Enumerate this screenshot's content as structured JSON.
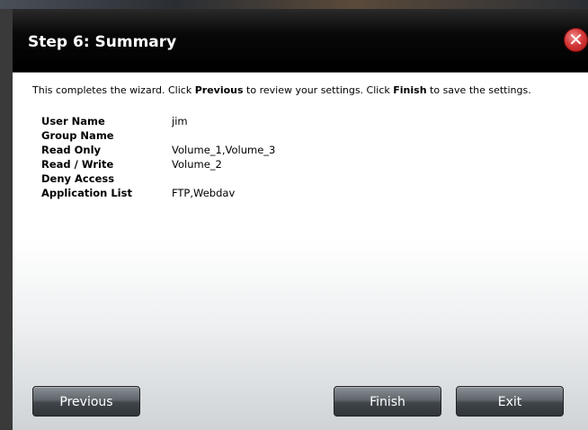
{
  "dialog": {
    "title": "Step 6: Summary",
    "close_label": "✕"
  },
  "intro": {
    "part1": "This completes the wizard. Click ",
    "previous_word": "Previous",
    "part2": " to review your settings. Click ",
    "finish_word": "Finish",
    "part3": " to save the settings."
  },
  "summary": [
    {
      "label": "User Name",
      "value": "jim"
    },
    {
      "label": "Group Name",
      "value": ""
    },
    {
      "label": "Read Only",
      "value": "Volume_1,Volume_3"
    },
    {
      "label": "Read / Write",
      "value": "Volume_2"
    },
    {
      "label": "Deny Access",
      "value": ""
    },
    {
      "label": "Application List",
      "value": "FTP,Webdav"
    }
  ],
  "buttons": {
    "previous": "Previous",
    "finish": "Finish",
    "exit": "Exit"
  }
}
